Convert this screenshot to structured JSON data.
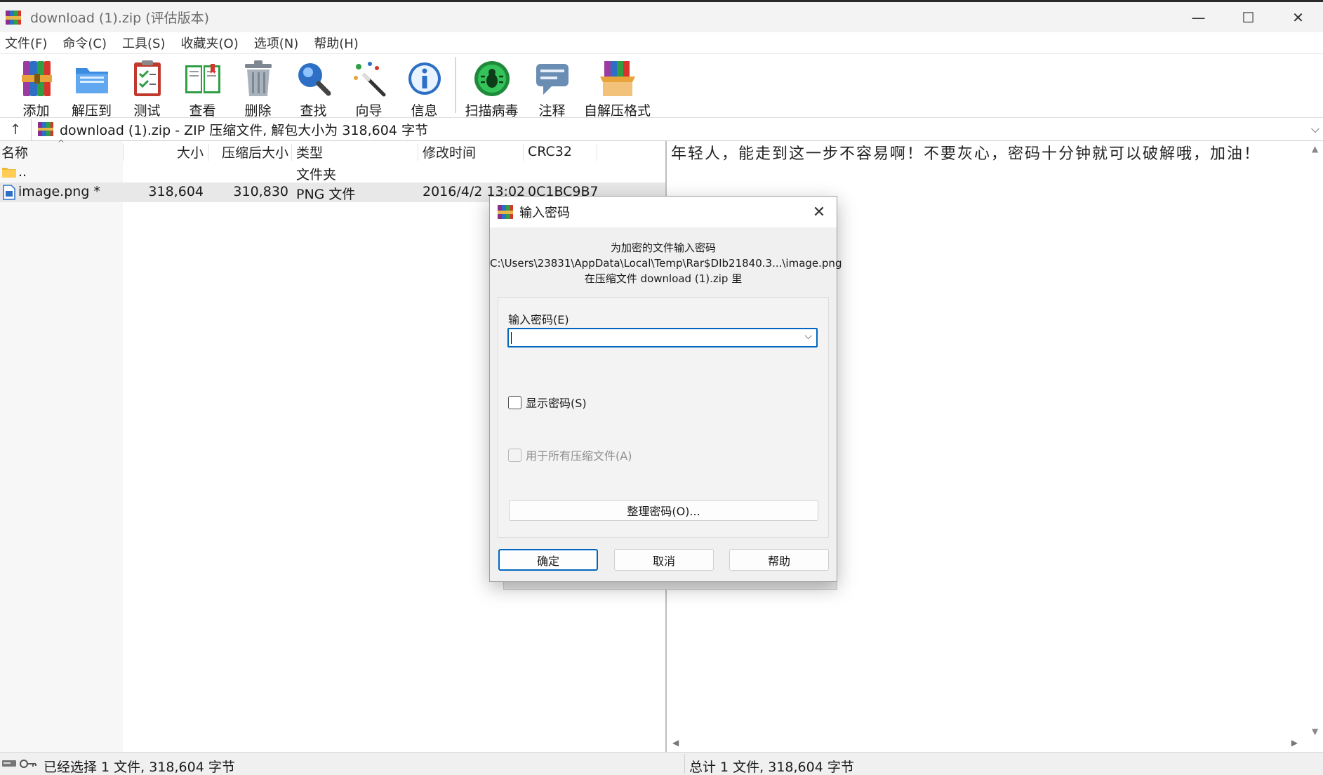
{
  "window": {
    "title": "download (1).zip (评估版本)",
    "controls": {
      "minimize": "—",
      "maximize": "☐",
      "close": "✕"
    }
  },
  "menu": [
    "文件(F)",
    "命令(C)",
    "工具(S)",
    "收藏夹(O)",
    "选项(N)",
    "帮助(H)"
  ],
  "toolbar": {
    "add": "添加",
    "extract": "解压到",
    "test": "测试",
    "view": "查看",
    "delete": "删除",
    "find": "查找",
    "wizard": "向导",
    "info": "信息",
    "scan": "扫描病毒",
    "comment": "注释",
    "sfx": "自解压格式"
  },
  "pathbar": {
    "up": "↑",
    "path": "download (1).zip - ZIP 压缩文件, 解包大小为 318,604 字节",
    "dropdown": "⌵"
  },
  "filelist": {
    "columns": [
      "名称",
      "大小",
      "压缩后大小",
      "类型",
      "修改时间",
      "CRC32"
    ],
    "sort_indicator": "^",
    "rows": [
      {
        "name": "..",
        "size": "",
        "packed": "",
        "type": "文件夹",
        "modified": "",
        "crc": ""
      },
      {
        "name": "image.png *",
        "size": "318,604",
        "packed": "310,830",
        "type": "PNG 文件",
        "modified": "2016/4/2 13:02",
        "crc": "0C1BC9B7"
      }
    ]
  },
  "comment": {
    "text": "年轻人，能走到这一步不容易啊！不要灰心，密码十分钟就可以破解哦，加油！",
    "scroll_up": "▲",
    "scroll_down": "▼",
    "scroll_left": "◀",
    "scroll_right": "▶"
  },
  "status": {
    "left": "已经选择 1 文件, 318,604 字节",
    "right": "总计 1 文件, 318,604 字节"
  },
  "dialog": {
    "title": "输入密码",
    "close": "✕",
    "info_line1": "为加密的文件输入密码",
    "info_line2": "C:\\Users\\23831\\AppData\\Local\\Temp\\Rar$DIb21840.3...\\image.png",
    "info_line3": "在压缩文件 download (1).zip 里",
    "password_label": "输入密码(E)",
    "password_value": "",
    "password_dropdown": "⌵",
    "show_password": "显示密码(S)",
    "use_for_all": "用于所有压缩文件(A)",
    "organize": "整理密码(O)...",
    "ok": "确定",
    "cancel": "取消",
    "help": "帮助"
  },
  "colors": {
    "accent": "#0067c0",
    "titlebar_bg": "#f3f3f3",
    "dialog_bg": "#f0f0f0",
    "selection": "#e8e8e8"
  }
}
